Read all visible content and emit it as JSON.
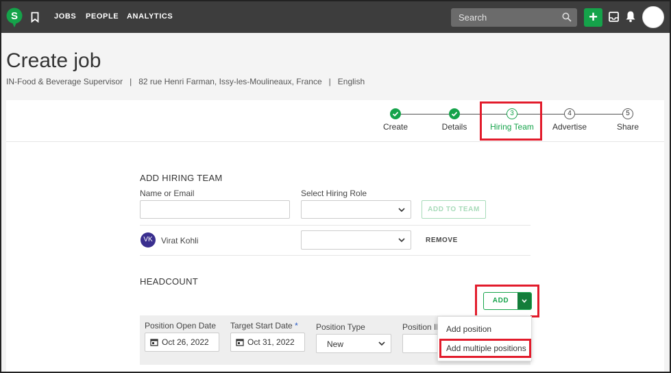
{
  "colors": {
    "topbar": "#3d3d3d",
    "accent": "#15a34a",
    "highlight": "#e21b2b",
    "avatar": "#3a2f8f"
  },
  "topbar": {
    "logo_letter": "S",
    "nav": [
      "JOBS",
      "PEOPLE",
      "ANALYTICS"
    ],
    "search_placeholder": "Search",
    "add_label": "+"
  },
  "header": {
    "title": "Create job",
    "subtitle": [
      "IN-Food & Beverage Supervisor",
      "82 rue Henri Farman, Issy-les-Moulineaux, France",
      "English"
    ],
    "separator": "|"
  },
  "steps": [
    {
      "number": "1",
      "label": "Create",
      "state": "done"
    },
    {
      "number": "2",
      "label": "Details",
      "state": "done"
    },
    {
      "number": "3",
      "label": "Hiring Team",
      "state": "active"
    },
    {
      "number": "4",
      "label": "Advertise",
      "state": "todo"
    },
    {
      "number": "5",
      "label": "Share",
      "state": "todo"
    }
  ],
  "hiring_team": {
    "title": "ADD HIRING TEAM",
    "name_label": "Name or Email",
    "role_label": "Select Hiring Role",
    "add_button": "ADD TO TEAM",
    "member": {
      "initials": "VK",
      "name": "Virat Kohli",
      "remove": "REMOVE"
    }
  },
  "headcount": {
    "title": "HEADCOUNT",
    "add_button": "ADD",
    "menu": [
      "Add position",
      "Add multiple positions"
    ],
    "columns": {
      "open_date_label": "Position Open Date",
      "open_date_value": "Oct 26, 2022",
      "start_date_label": "Target Start Date",
      "required_mark": "*",
      "start_date_value": "Oct 31, 2022",
      "type_label": "Position Type",
      "type_value": "New",
      "id_label": "Position ID"
    }
  }
}
